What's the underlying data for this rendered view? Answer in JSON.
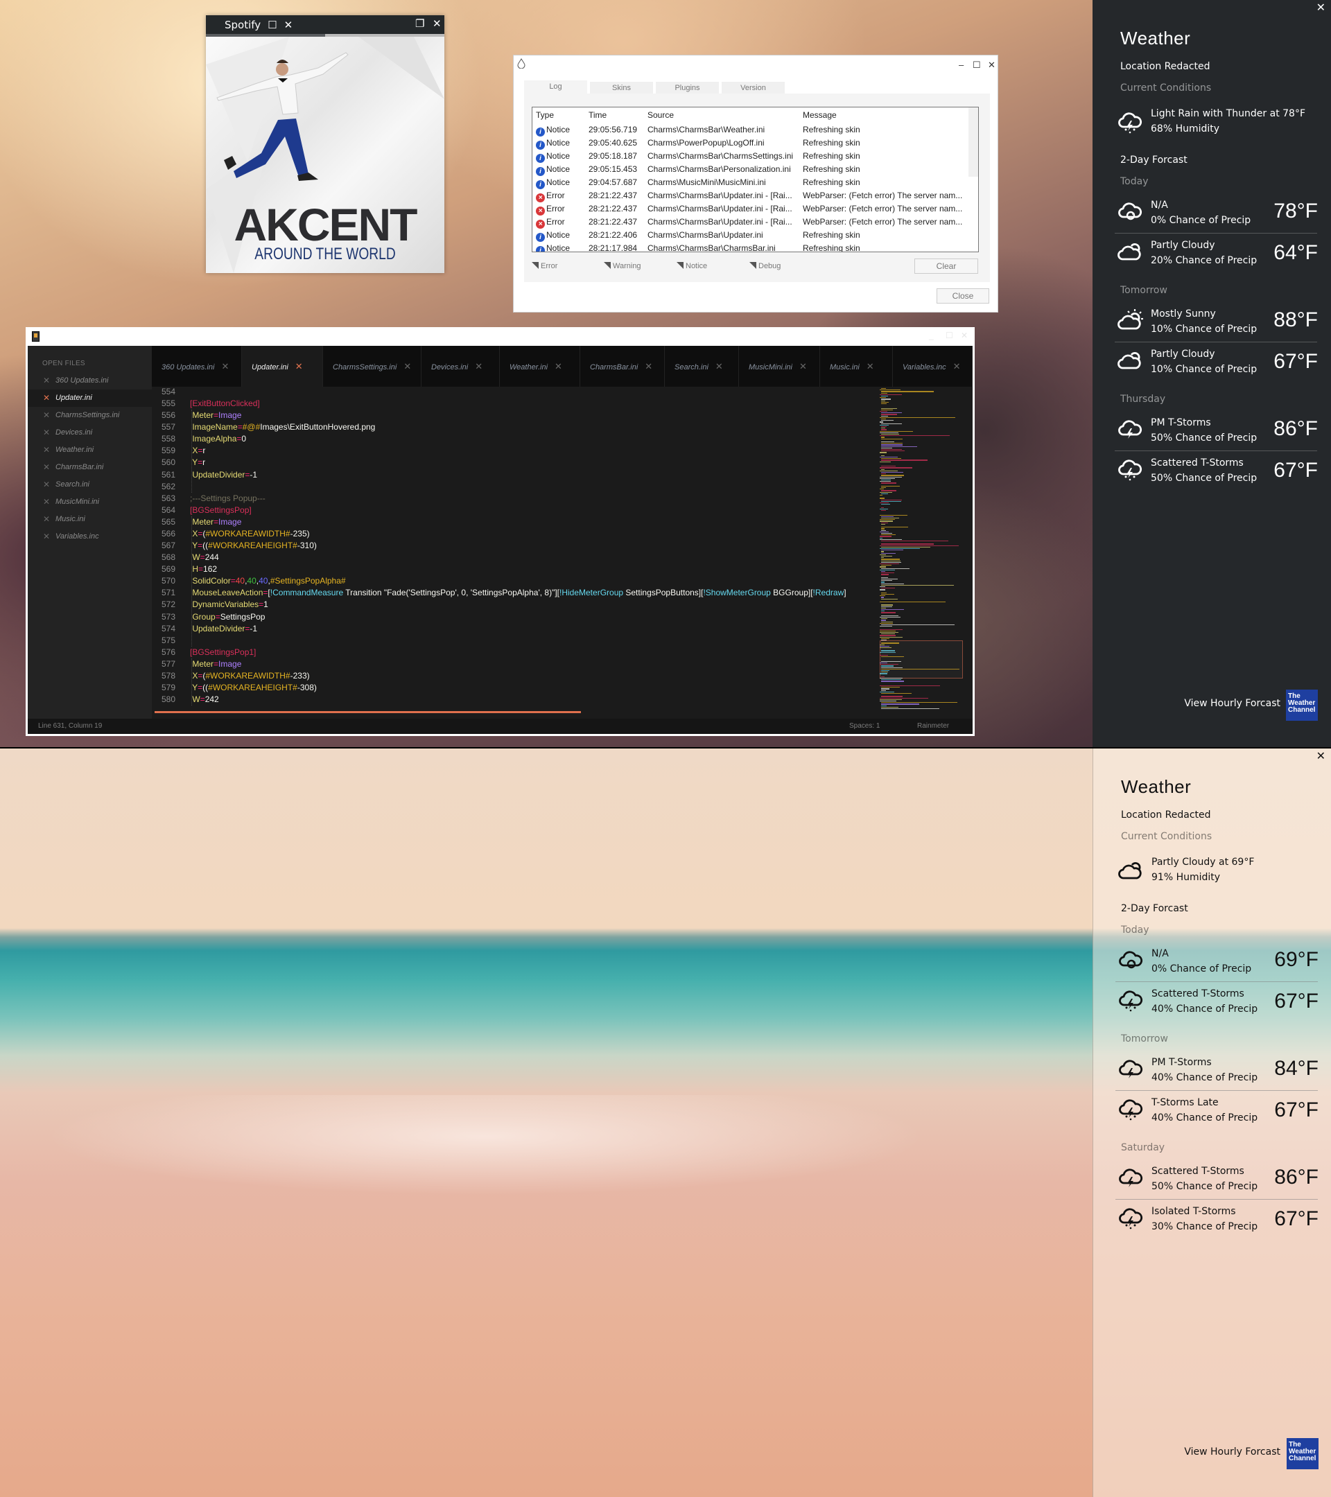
{
  "spotify": {
    "title": "Spotify",
    "progress": 0.5,
    "album_logo": "AKCENT",
    "album_subtitle": "AROUND THE WORLD"
  },
  "log_window": {
    "tabs": [
      "Log",
      "Skins",
      "Plugins",
      "Version"
    ],
    "active_tab": "Log",
    "columns": [
      "Type",
      "Time",
      "Source",
      "Message"
    ],
    "rows": [
      {
        "type": "Notice",
        "time": "29:05:56.719",
        "source": "Charms\\CharmsBar\\Weather.ini",
        "message": "Refreshing skin"
      },
      {
        "type": "Notice",
        "time": "29:05:40.625",
        "source": "Charms\\PowerPopup\\LogOff.ini",
        "message": "Refreshing skin"
      },
      {
        "type": "Notice",
        "time": "29:05:18.187",
        "source": "Charms\\CharmsBar\\CharmsSettings.ini",
        "message": "Refreshing skin"
      },
      {
        "type": "Notice",
        "time": "29:05:15.453",
        "source": "Charms\\CharmsBar\\Personalization.ini",
        "message": "Refreshing skin"
      },
      {
        "type": "Notice",
        "time": "29:04:57.687",
        "source": "Charms\\MusicMini\\MusicMini.ini",
        "message": "Refreshing skin"
      },
      {
        "type": "Error",
        "time": "28:21:22.437",
        "source": "Charms\\CharmsBar\\Updater.ini - [Rai...",
        "message": "WebParser: (Fetch error) The server nam..."
      },
      {
        "type": "Error",
        "time": "28:21:22.437",
        "source": "Charms\\CharmsBar\\Updater.ini - [Rai...",
        "message": "WebParser: (Fetch error) The server nam..."
      },
      {
        "type": "Error",
        "time": "28:21:22.437",
        "source": "Charms\\CharmsBar\\Updater.ini - [Rai...",
        "message": "WebParser: (Fetch error) The server nam..."
      },
      {
        "type": "Notice",
        "time": "28:21:22.406",
        "source": "Charms\\CharmsBar\\Updater.ini",
        "message": "Refreshing skin"
      },
      {
        "type": "Notice",
        "time": "28:21:17.984",
        "source": "Charms\\CharmsBar\\CharmsBar.ini",
        "message": "Refreshing skin"
      }
    ],
    "filters": [
      "Error",
      "Warning",
      "Notice",
      "Debug"
    ],
    "clear_label": "Clear",
    "close_label": "Close"
  },
  "editor": {
    "sidebar_heading": "OPEN FILES",
    "open_files": [
      "360 Updates.ini",
      "Updater.ini",
      "CharmsSettings.ini",
      "Devices.ini",
      "Weather.ini",
      "CharmsBar.ini",
      "Search.ini",
      "MusicMini.ini",
      "Music.ini",
      "Variables.inc"
    ],
    "active_file": "Updater.ini",
    "tabs": [
      "360 Updates.ini",
      "Updater.ini",
      "CharmsSettings.ini",
      "Devices.ini",
      "Weather.ini",
      "CharmsBar.ini",
      "Search.ini",
      "MusicMini.ini",
      "Music.ini",
      "Variables.inc"
    ],
    "code_lines": [
      {
        "n": 554,
        "tokens": []
      },
      {
        "n": 555,
        "tokens": [
          [
            "sec",
            "[ExitButtonClicked]"
          ]
        ]
      },
      {
        "n": 556,
        "tokens": [
          [
            "key",
            " Meter"
          ],
          [
            "eq",
            "="
          ],
          [
            "type",
            "Image"
          ]
        ]
      },
      {
        "n": 557,
        "tokens": [
          [
            "key",
            " ImageName"
          ],
          [
            "eq",
            "="
          ],
          [
            "var",
            "#@#"
          ],
          [
            "val",
            "Images\\ExitButtonHovered.png"
          ]
        ]
      },
      {
        "n": 558,
        "tokens": [
          [
            "key",
            " ImageAlpha"
          ],
          [
            "eq",
            "="
          ],
          [
            "val",
            "0"
          ]
        ]
      },
      {
        "n": 559,
        "tokens": [
          [
            "key",
            " X"
          ],
          [
            "eq",
            "="
          ],
          [
            "val",
            "r"
          ]
        ]
      },
      {
        "n": 560,
        "tokens": [
          [
            "key",
            " Y"
          ],
          [
            "eq",
            "="
          ],
          [
            "val",
            "r"
          ]
        ]
      },
      {
        "n": 561,
        "tokens": [
          [
            "key",
            " UpdateDivider"
          ],
          [
            "eq",
            "="
          ],
          [
            "val",
            "-1"
          ]
        ]
      },
      {
        "n": 562,
        "tokens": []
      },
      {
        "n": 563,
        "tokens": [
          [
            "com",
            ";---Settings Popup---"
          ]
        ]
      },
      {
        "n": 564,
        "tokens": [
          [
            "sec",
            "[BGSettingsPop]"
          ]
        ]
      },
      {
        "n": 565,
        "tokens": [
          [
            "key",
            " Meter"
          ],
          [
            "eq",
            "="
          ],
          [
            "type",
            "Image"
          ]
        ]
      },
      {
        "n": 566,
        "tokens": [
          [
            "key",
            " X"
          ],
          [
            "eq",
            "="
          ],
          [
            "val",
            "("
          ],
          [
            "var",
            "#WORKAREAWIDTH#"
          ],
          [
            "val",
            "-235)"
          ]
        ]
      },
      {
        "n": 567,
        "tokens": [
          [
            "key",
            " Y"
          ],
          [
            "eq",
            "="
          ],
          [
            "val",
            "(("
          ],
          [
            "var",
            "#WORKAREAHEIGHT#"
          ],
          [
            "val",
            "-310)"
          ]
        ]
      },
      {
        "n": 568,
        "tokens": [
          [
            "key",
            " W"
          ],
          [
            "eq",
            "="
          ],
          [
            "val",
            "244"
          ]
        ]
      },
      {
        "n": 569,
        "tokens": [
          [
            "key",
            " H"
          ],
          [
            "eq",
            "="
          ],
          [
            "val",
            "162"
          ]
        ]
      },
      {
        "n": 570,
        "tokens": [
          [
            "key",
            " SolidColor"
          ],
          [
            "eq",
            "="
          ],
          [
            "r",
            "40"
          ],
          [
            "val",
            ","
          ],
          [
            "g",
            "40"
          ],
          [
            "val",
            ","
          ],
          [
            "b",
            "40"
          ],
          [
            "val",
            ","
          ],
          [
            "var",
            "#SettingsPopAlpha#"
          ]
        ]
      },
      {
        "n": 571,
        "tokens": [
          [
            "key",
            " MouseLeaveAction"
          ],
          [
            "eq",
            "="
          ],
          [
            "val",
            "["
          ],
          [
            "bang",
            "!CommandMeasure"
          ],
          [
            "val",
            " Transition \"Fade('SettingsPop', 0, 'SettingsPopAlpha', 8)\"]["
          ],
          [
            "bang",
            "!HideMeterGroup"
          ],
          [
            "val",
            " SettingsPopButtons]["
          ],
          [
            "bang",
            "!ShowMeterGroup"
          ],
          [
            "val",
            " BGGroup]["
          ],
          [
            "bang",
            "!Redraw"
          ],
          [
            "val",
            "]"
          ]
        ]
      },
      {
        "n": 572,
        "tokens": [
          [
            "key",
            " DynamicVariables"
          ],
          [
            "eq",
            "="
          ],
          [
            "val",
            "1"
          ]
        ]
      },
      {
        "n": 573,
        "tokens": [
          [
            "key",
            " Group"
          ],
          [
            "eq",
            "="
          ],
          [
            "val",
            "SettingsPop"
          ]
        ]
      },
      {
        "n": 574,
        "tokens": [
          [
            "key",
            " UpdateDivider"
          ],
          [
            "eq",
            "="
          ],
          [
            "val",
            "-1"
          ]
        ]
      },
      {
        "n": 575,
        "tokens": []
      },
      {
        "n": 576,
        "tokens": [
          [
            "sec",
            "[BGSettingsPop1]"
          ]
        ]
      },
      {
        "n": 577,
        "tokens": [
          [
            "key",
            " Meter"
          ],
          [
            "eq",
            "="
          ],
          [
            "type",
            "Image"
          ]
        ]
      },
      {
        "n": 578,
        "tokens": [
          [
            "key",
            " X"
          ],
          [
            "eq",
            "="
          ],
          [
            "val",
            "("
          ],
          [
            "var",
            "#WORKAREAWIDTH#"
          ],
          [
            "val",
            "-233)"
          ]
        ]
      },
      {
        "n": 579,
        "tokens": [
          [
            "key",
            " Y"
          ],
          [
            "eq",
            "="
          ],
          [
            "val",
            "(("
          ],
          [
            "var",
            "#WORKAREAHEIGHT#"
          ],
          [
            "val",
            "-308)"
          ]
        ]
      },
      {
        "n": 580,
        "tokens": [
          [
            "key",
            " W"
          ],
          [
            "eq",
            "="
          ],
          [
            "val",
            "242"
          ]
        ]
      }
    ],
    "status_position": "Line 631, Column 19",
    "status_spaces": "Spaces: 1",
    "status_syntax": "Rainmeter",
    "accent_color": "#e0704d"
  },
  "weather_panels": [
    {
      "theme": "dark",
      "title": "Weather",
      "location": "Location Redacted",
      "current_label": "Current Conditions",
      "current": {
        "icon": "thunder-rain",
        "condition": "Light Rain with Thunder at 78°F",
        "humidity": "68% Humidity"
      },
      "forecast_label": "2-Day Forcast",
      "days": [
        {
          "label": "Today",
          "items": [
            {
              "icon": "na",
              "condition": "N/A",
              "precip": "0% Chance of Precip",
              "temp": "78°F"
            },
            {
              "icon": "partly-cloudy",
              "condition": "Partly Cloudy",
              "precip": "20% Chance of Precip",
              "temp": "64°F"
            }
          ]
        },
        {
          "label": "Tomorrow",
          "items": [
            {
              "icon": "mostly-sunny",
              "condition": "Mostly Sunny",
              "precip": "10% Chance of Precip",
              "temp": "88°F"
            },
            {
              "icon": "partly-cloudy",
              "condition": "Partly Cloudy",
              "precip": "10% Chance of Precip",
              "temp": "67°F"
            }
          ]
        },
        {
          "label": "Thursday",
          "items": [
            {
              "icon": "t-storm",
              "condition": "PM T-Storms",
              "precip": "50% Chance of Precip",
              "temp": "86°F"
            },
            {
              "icon": "thunder-rain",
              "condition": "Scattered T-Storms",
              "precip": "50% Chance of Precip",
              "temp": "67°F"
            }
          ]
        }
      ],
      "hourly_link": "View Hourly Forcast",
      "logo_text": "The Weather Channel"
    },
    {
      "theme": "light",
      "title": "Weather",
      "location": "Location Redacted",
      "current_label": "Current Conditions",
      "current": {
        "icon": "partly-cloudy",
        "condition": "Partly Cloudy at 69°F",
        "humidity": "91% Humidity"
      },
      "forecast_label": "2-Day Forcast",
      "days": [
        {
          "label": "Today",
          "items": [
            {
              "icon": "na",
              "condition": "N/A",
              "precip": "0% Chance of Precip",
              "temp": "69°F"
            },
            {
              "icon": "thunder-rain",
              "condition": "Scattered T-Storms",
              "precip": "40% Chance of Precip",
              "temp": "67°F"
            }
          ]
        },
        {
          "label": "Tomorrow",
          "items": [
            {
              "icon": "t-storm",
              "condition": "PM T-Storms",
              "precip": "40% Chance of Precip",
              "temp": "84°F"
            },
            {
              "icon": "thunder-rain",
              "condition": "T-Storms Late",
              "precip": "40% Chance of Precip",
              "temp": "67°F"
            }
          ]
        },
        {
          "label": "Saturday",
          "items": [
            {
              "icon": "t-storm",
              "condition": "Scattered T-Storms",
              "precip": "50% Chance of Precip",
              "temp": "86°F"
            },
            {
              "icon": "thunder-rain",
              "condition": "Isolated T-Storms",
              "precip": "30% Chance of Precip",
              "temp": "67°F"
            }
          ]
        }
      ],
      "hourly_link": "View Hourly Forcast",
      "logo_text": "The Weather Channel"
    }
  ]
}
